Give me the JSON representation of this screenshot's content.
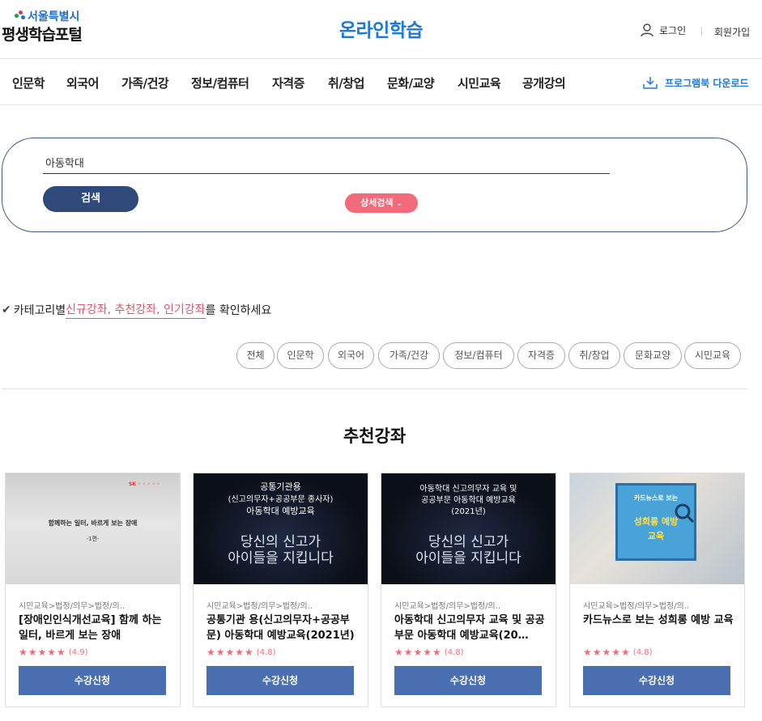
{
  "header": {
    "logo_top": "서울특별시",
    "logo_bottom": "평생학습포털",
    "title": "온라인학습",
    "login": "로그인",
    "signup": "회원가입"
  },
  "nav": {
    "items": [
      "인문학",
      "외국어",
      "가족/건강",
      "정보/컴퓨터",
      "자격증",
      "취/창업",
      "문화/교양",
      "시민교육",
      "공개강의"
    ],
    "download": "프로그램북 다운로드"
  },
  "search": {
    "value": "아동학대",
    "button": "검색",
    "advanced": "상세검색"
  },
  "category_message": {
    "prefix": "카테고리별 ",
    "highlight": "신규강좌, 추천강좌, 인기강좌",
    "suffix": "를 확인하세요"
  },
  "filters": [
    "전체",
    "인문학",
    "외국어",
    "가족/건강",
    "정보/컴퓨터",
    "자격증",
    "취/창업",
    "문화교양",
    "시민교육"
  ],
  "section_title": "추천강좌",
  "courses": [
    {
      "category": "시민교육>법정/의무>법정/의..",
      "title": "[장애인인식개선교육] 함께 하는 일터, 바르게 보는 장애",
      "rating": "(4.9)",
      "button": "수강신청",
      "thumb_line1": "함께하는 일터, 바르게 보는 장애",
      "thumb_line2": "-1편-"
    },
    {
      "category": "시민교육>법정/의무>법정/의..",
      "title": "공통기관 용(신고의무자+공공부문) 아동학대 예방교육(2021년)",
      "rating": "(4.8)",
      "button": "수강신청",
      "thumb_line1": "공통기관용",
      "thumb_line2": "(신고의무자+공공부문 종사자)",
      "thumb_line3": "아동학대 예방교육",
      "thumb_line4": "당신의 신고가",
      "thumb_line5": "아이들을 지킵니다"
    },
    {
      "category": "시민교육>법정/의무>법정/의..",
      "title": "아동학대 신고의무자 교육 및 공공부문 아동학대 예방교육(20…",
      "rating": "(4.8)",
      "button": "수강신청",
      "thumb_line1": "아동학대 신고의무자 교육 및",
      "thumb_line2": "공공부문 아동학대 예방교육",
      "thumb_line3": "(2021년)",
      "thumb_line4": "당신의 신고가",
      "thumb_line5": "아이들을 지킵니다"
    },
    {
      "category": "시민교육>법정/의무>법정/의..",
      "title": "카드뉴스로 보는 성희롱 예방 교육",
      "rating": "(4.8)",
      "button": "수강신청",
      "thumb_line1": "카드뉴스로 보는",
      "thumb_line2": "성희롱 예방",
      "thumb_line3": "교육"
    }
  ],
  "stars": "★★★★★",
  "colors": {
    "brand_blue": "#1e78d6",
    "search_button": "#2f4a7a",
    "advanced_button": "#f26b7a",
    "enroll_button": "#4a6fb0",
    "highlight": "#e8506a"
  }
}
